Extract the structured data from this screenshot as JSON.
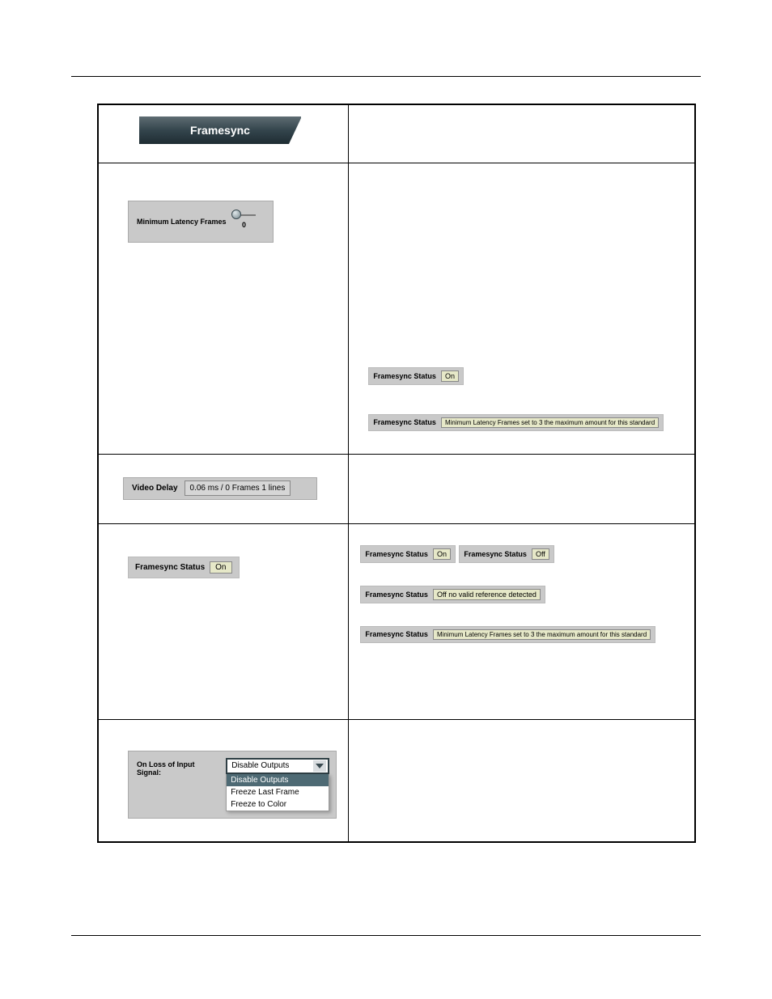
{
  "header_tab": "Framesync",
  "row2": {
    "label": "Minimum Latency Frames",
    "value": "0",
    "status_a": {
      "label": "Framesync Status",
      "value": "On"
    },
    "status_b": {
      "label": "Framesync Status",
      "value": "Minimum Latency Frames set to 3 the maximum amount for this standard"
    }
  },
  "row3": {
    "label": "Video Delay",
    "value": "0.06 ms / 0 Frames 1 lines"
  },
  "row4": {
    "left": {
      "label": "Framesync Status",
      "value": "On"
    },
    "s1": {
      "label": "Framesync Status",
      "value": "On"
    },
    "s2": {
      "label": "Framesync Status",
      "value": "Off"
    },
    "s3": {
      "label": "Framesync Status",
      "value": "Off no valid reference detected"
    },
    "s4": {
      "label": "Framesync Status",
      "value": "Minimum Latency Frames set to 3 the maximum amount for this standard"
    }
  },
  "row5": {
    "label": "On Loss of Input Signal:",
    "selected": "Disable Outputs",
    "options": [
      "Disable Outputs",
      "Freeze Last Frame",
      "Freeze to Color"
    ]
  }
}
